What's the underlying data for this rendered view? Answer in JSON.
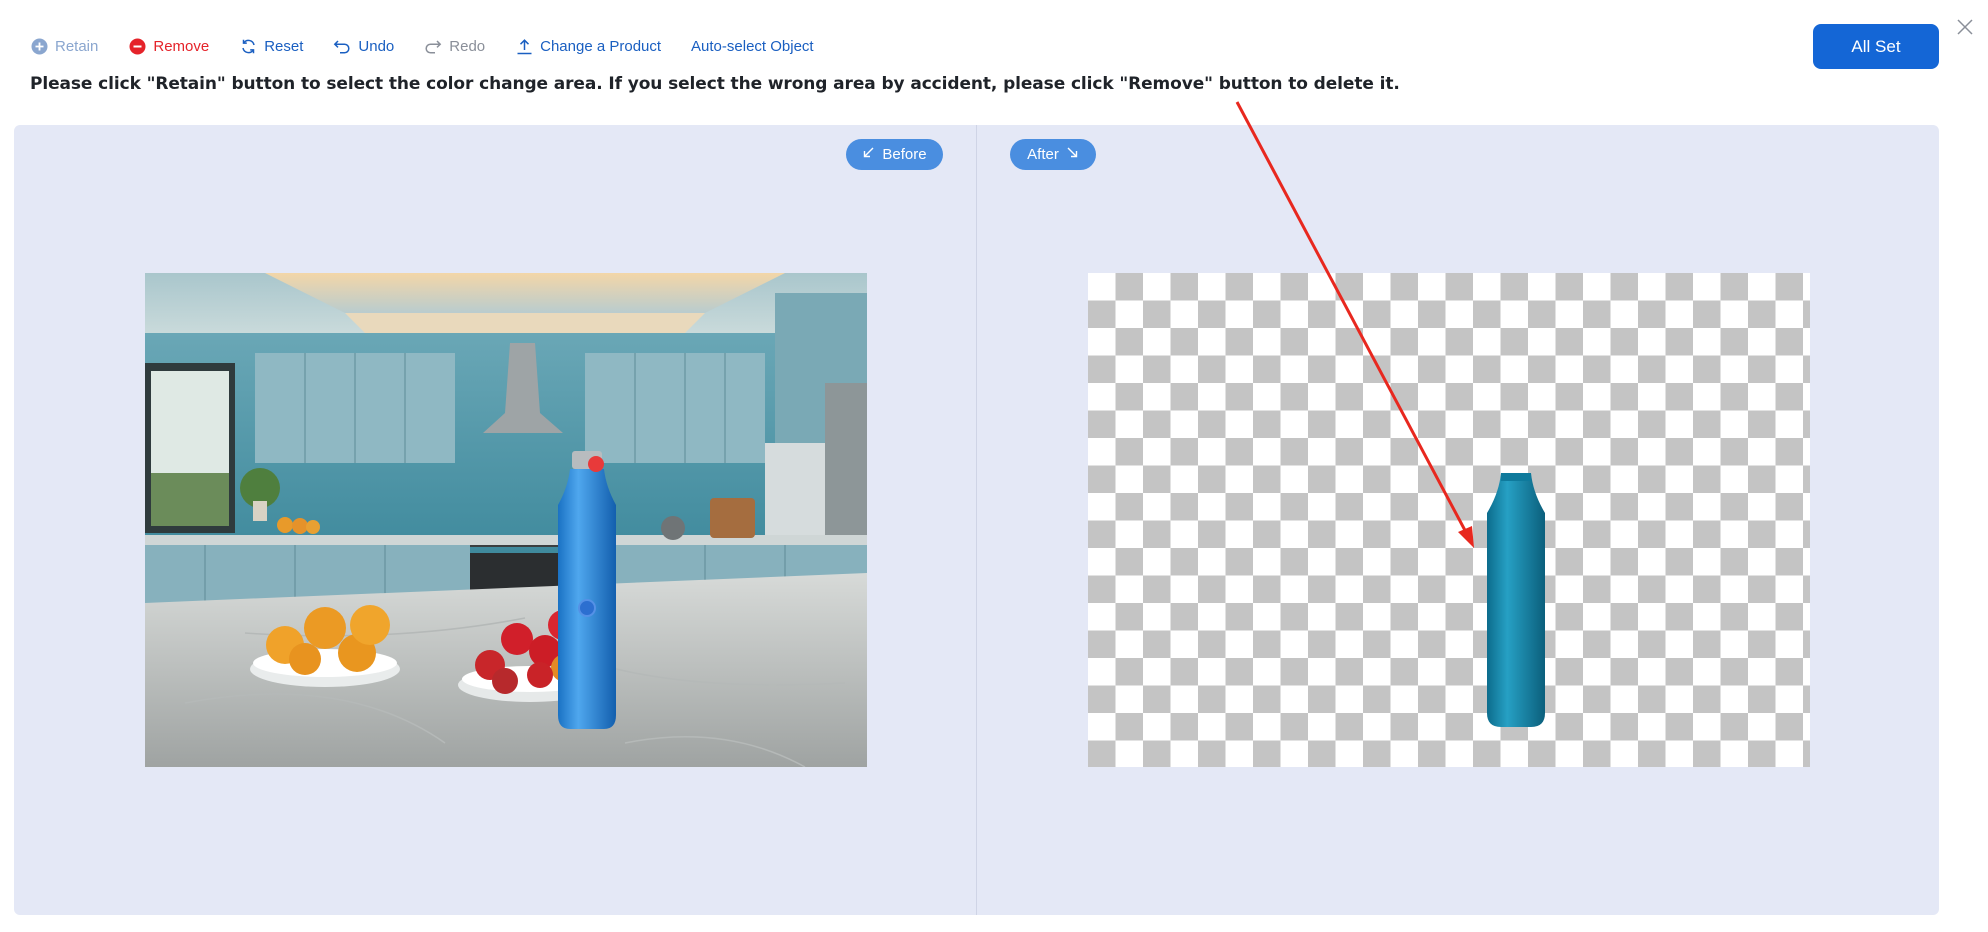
{
  "toolbar": {
    "retain": "Retain",
    "remove": "Remove",
    "reset": "Reset",
    "undo": "Undo",
    "redo": "Redo",
    "change_product": "Change a Product",
    "auto_select": "Auto-select Object"
  },
  "all_set": "All Set",
  "instruction": "Please click \"Retain\" button to select the color change area. If you select the wrong area by accident, please click \"Remove\" button to delete it.",
  "panels": {
    "before_label": "Before",
    "after_label": "After"
  },
  "colors": {
    "accent": "#1466d6",
    "pill": "#4a8ee0",
    "remove": "#e5232a",
    "canvas_bg": "#e4e8f6",
    "annotation_arrow": "#e8281f"
  },
  "icons": {
    "retain": "plus-circle-icon",
    "remove": "minus-circle-icon",
    "reset": "refresh-icon",
    "undo": "undo-icon",
    "redo": "redo-icon",
    "change_product": "upload-icon",
    "close": "close-icon"
  }
}
